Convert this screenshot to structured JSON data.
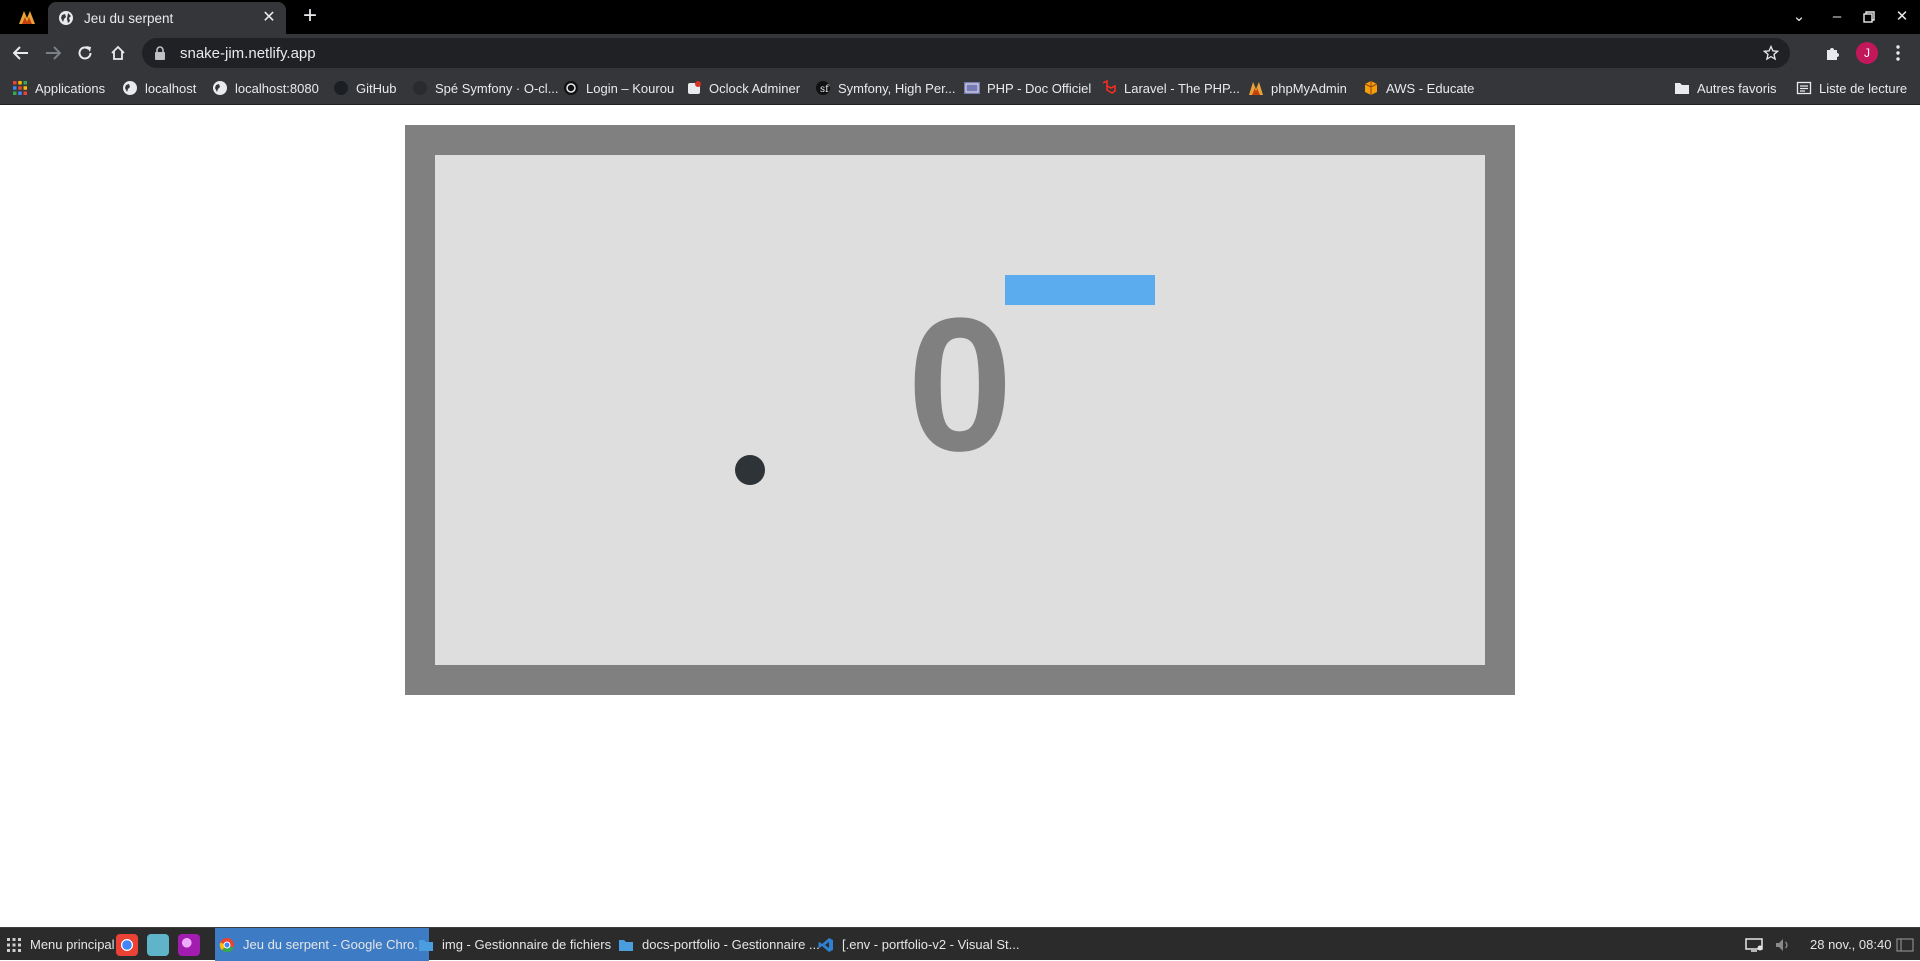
{
  "browser": {
    "tab": {
      "title": "Jeu du serpent"
    },
    "url": "snake-jim.netlify.app",
    "avatar_initial": "J"
  },
  "bookmarks": {
    "items": [
      {
        "label": "Applications",
        "icon": "apps-grid-icon"
      },
      {
        "label": "localhost",
        "icon": "globe-icon"
      },
      {
        "label": "localhost:8080",
        "icon": "globe-icon"
      },
      {
        "label": "GitHub",
        "icon": "github-icon"
      },
      {
        "label": "Spé Symfony · O-cl...",
        "icon": "oclock-icon"
      },
      {
        "label": "Login – Kourou",
        "icon": "kourou-icon"
      },
      {
        "label": "Oclock Adminer",
        "icon": "adminer-icon"
      },
      {
        "label": "Symfony, High Per...",
        "icon": "symfony-icon"
      },
      {
        "label": "PHP - Doc Officiel",
        "icon": "php-icon"
      },
      {
        "label": "Laravel - The PHP...",
        "icon": "laravel-icon"
      },
      {
        "label": "phpMyAdmin",
        "icon": "phpmyadmin-icon"
      },
      {
        "label": "AWS - Educate",
        "icon": "aws-icon"
      }
    ],
    "other_favorites": "Autres favoris",
    "reading_list": "Liste de lecture"
  },
  "game": {
    "score": "0",
    "colors": {
      "border": "#808080",
      "field": "#dedede",
      "snake": "#5aacee",
      "food": "#2e3338",
      "score": "#808080"
    }
  },
  "taskbar": {
    "menu_label": "Menu principal",
    "windows": [
      {
        "label": "Jeu du serpent - Google Chro...",
        "icon": "chrome-icon",
        "active": true
      },
      {
        "label": "img - Gestionnaire de fichiers",
        "icon": "folder-icon",
        "active": false
      },
      {
        "label": "docs-portfolio - Gestionnaire ...",
        "icon": "folder-icon",
        "active": false
      },
      {
        "label": "[.env - portfolio-v2 - Visual St...",
        "icon": "vscode-icon",
        "active": false
      }
    ],
    "clock": "28 nov., 08:40"
  }
}
